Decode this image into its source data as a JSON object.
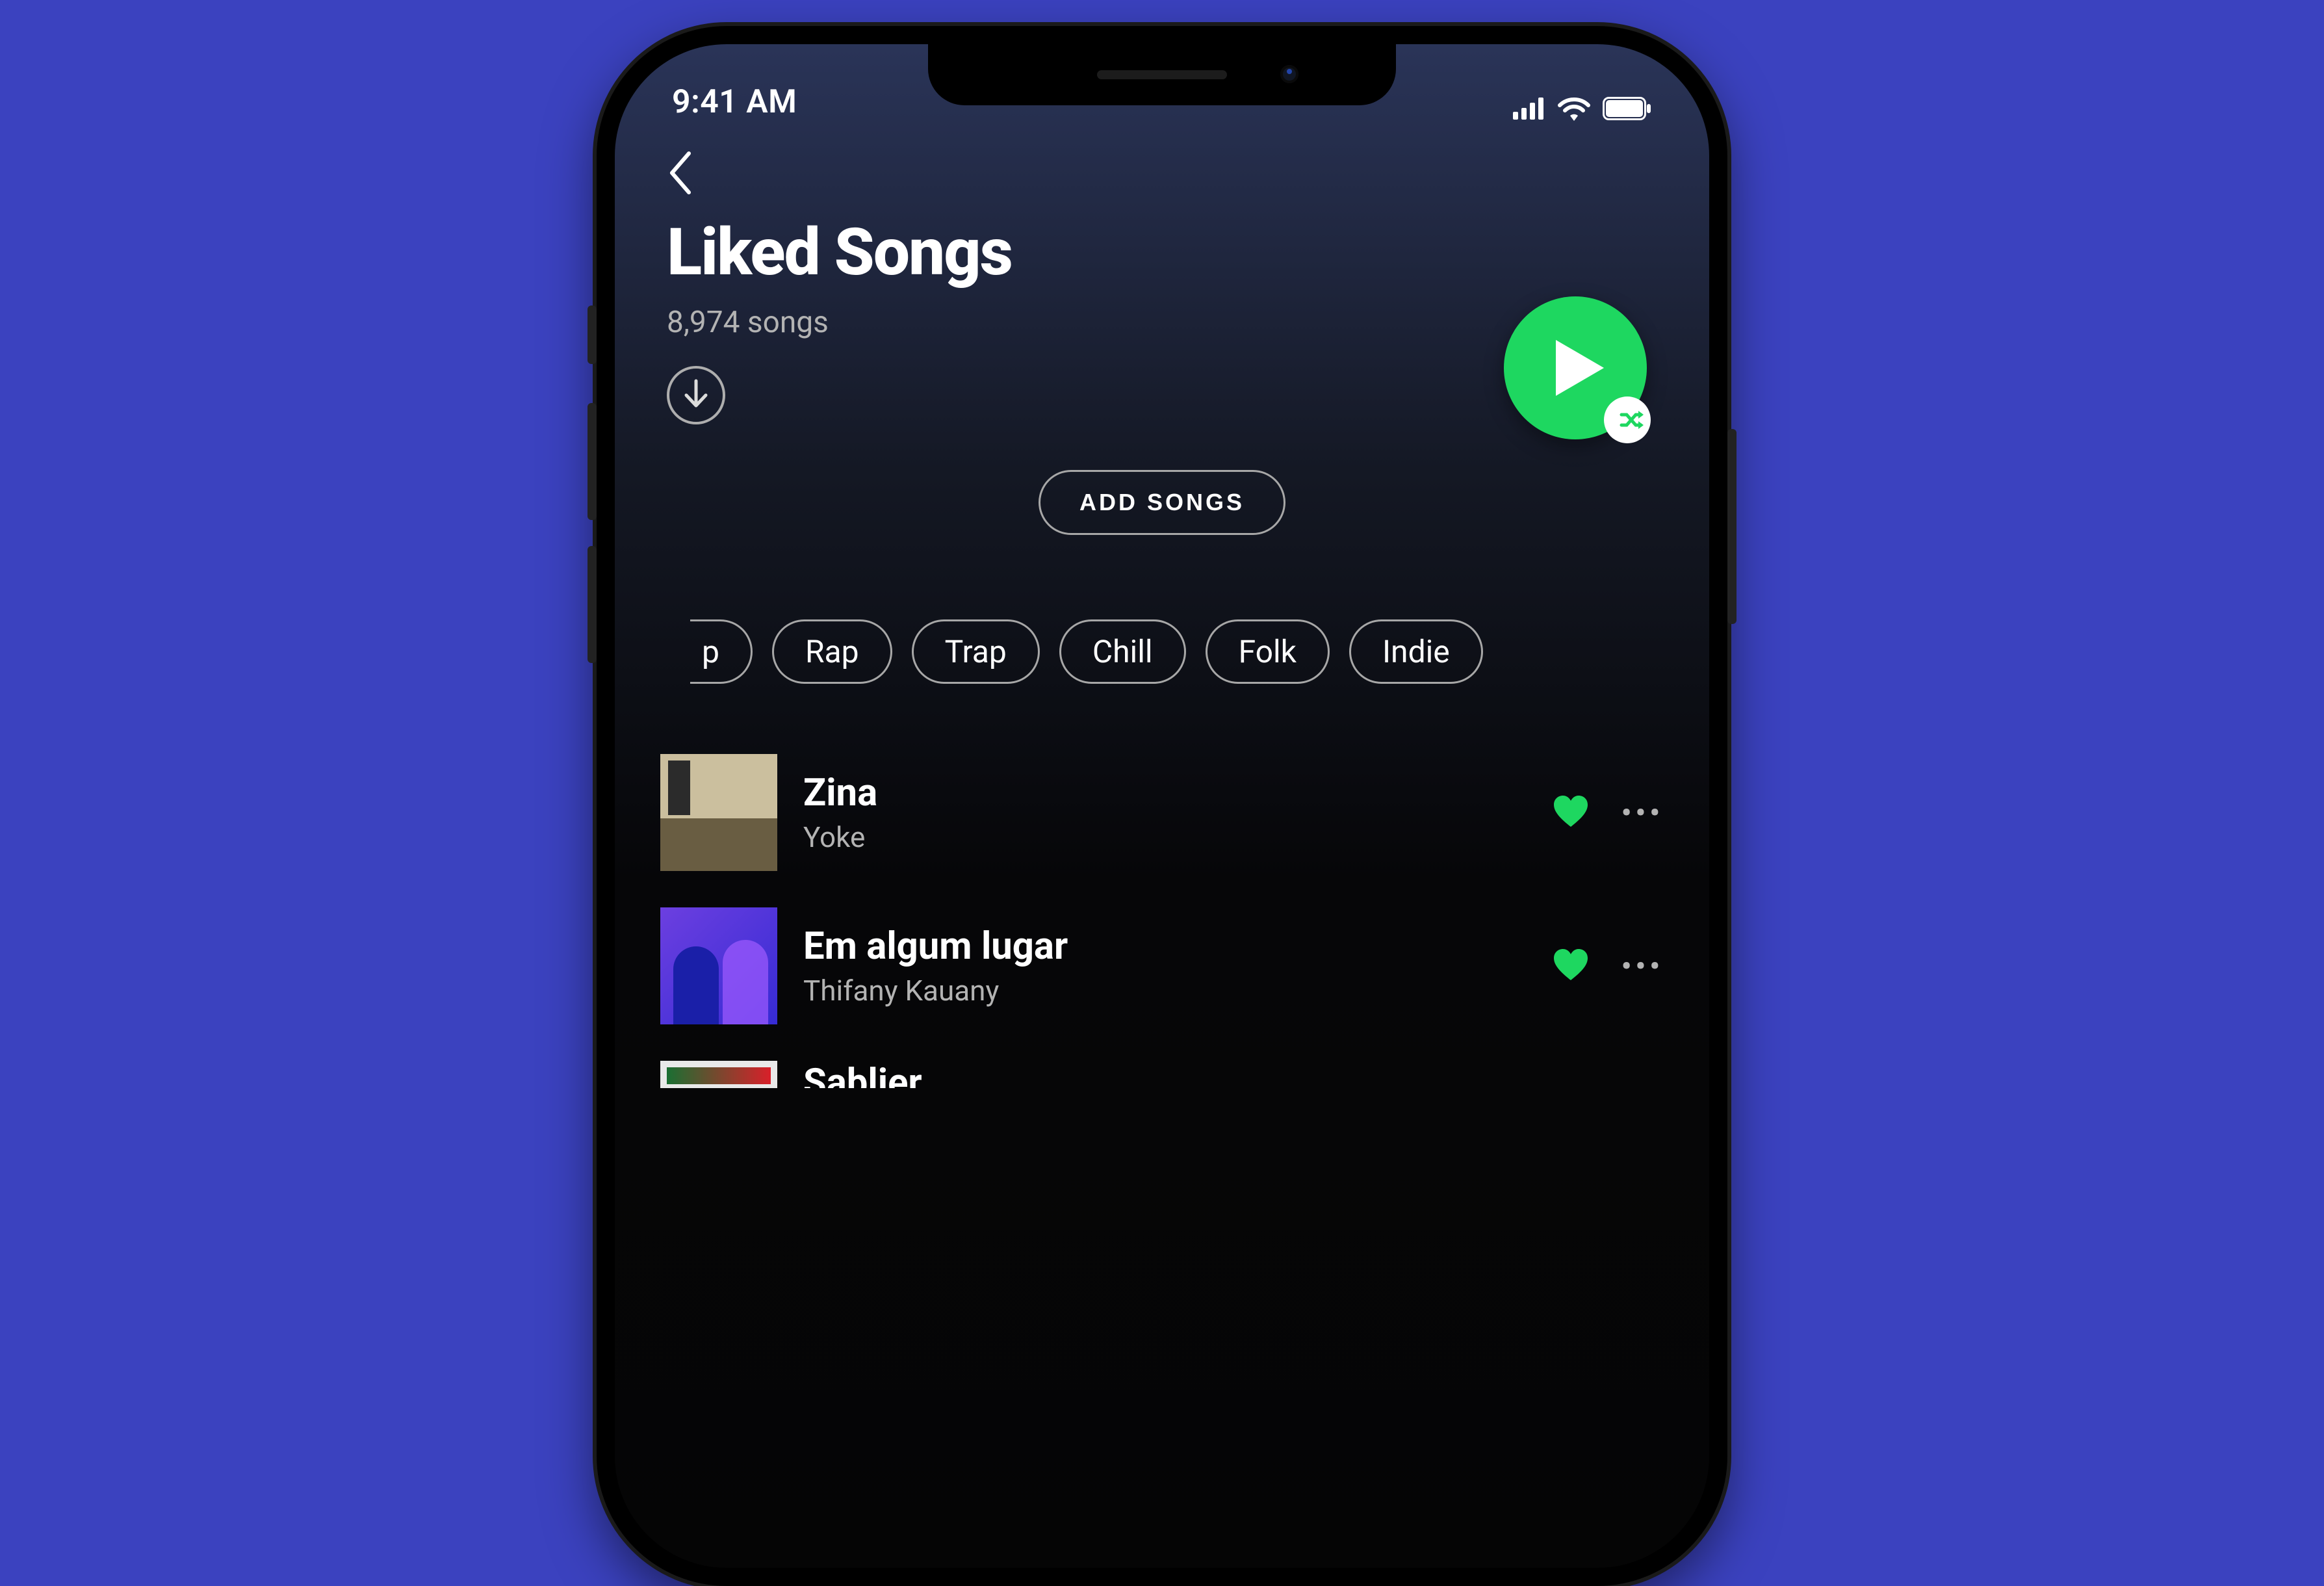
{
  "status": {
    "time": "9:41 AM"
  },
  "header": {
    "title": "Liked Songs",
    "subtitle": "8,974 songs",
    "add_songs_label": "ADD SONGS"
  },
  "filters": {
    "truncated_first_suffix": "p",
    "items": [
      "Rap",
      "Trap",
      "Chill",
      "Folk",
      "Indie"
    ]
  },
  "tracks": [
    {
      "title": "Zina",
      "artist": "Yoke",
      "art_class": "zina",
      "liked": true
    },
    {
      "title": "Em algum lugar",
      "artist": "Thifany Kauany",
      "art_class": "em",
      "liked": true
    },
    {
      "title": "Sablier",
      "artist": "",
      "art_class": "sablier",
      "liked": true
    }
  ],
  "colors": {
    "accent": "#1ed760",
    "background_stage": "#3B42BF"
  }
}
